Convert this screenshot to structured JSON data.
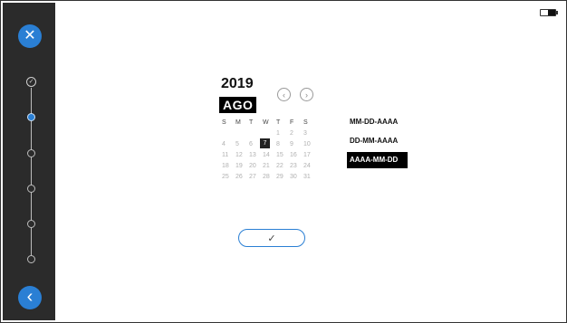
{
  "sidebar": {
    "close_icon": "close-icon",
    "back_icon": "chevron-left-icon",
    "close_glyph": "✕",
    "back_glyph": "‹",
    "steps": [
      {
        "state": "done"
      },
      {
        "state": "active"
      },
      {
        "state": "pending"
      },
      {
        "state": "pending"
      },
      {
        "state": "pending"
      },
      {
        "state": "pending"
      }
    ]
  },
  "calendar": {
    "year": "2019",
    "month": "AGO",
    "weekdays": [
      "S",
      "M",
      "T",
      "W",
      "T",
      "F",
      "S"
    ],
    "first_weekday_index": 4,
    "days_in_month": 31,
    "selected_day": 7
  },
  "formats": {
    "options": [
      "MM-DD-AAAA",
      "DD-MM-AAAA",
      "AAAA-MM-DD"
    ],
    "selected": "AAAA-MM-DD"
  },
  "confirm": {
    "glyph": "✓"
  },
  "colors": {
    "accent": "#2a7fd4",
    "sidebar_bg": "#2b2b2b"
  }
}
